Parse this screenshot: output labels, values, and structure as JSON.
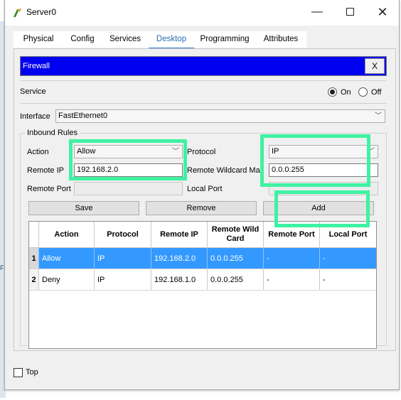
{
  "window": {
    "title": "Server0",
    "minimize": "—",
    "close": "✕"
  },
  "tabs": [
    "Physical",
    "Config",
    "Services",
    "Desktop",
    "Programming",
    "Attributes"
  ],
  "active_tab": "Desktop",
  "firewall": {
    "title": "Firewall",
    "close_label": "X"
  },
  "service": {
    "label": "Service",
    "on_label": "On",
    "off_label": "Off",
    "selected": "On"
  },
  "interface": {
    "label": "Interface",
    "value": "FastEthernet0"
  },
  "inbound_rules": {
    "title": "Inbound Rules",
    "action_label": "Action",
    "action_value": "Allow",
    "protocol_label": "Protocol",
    "protocol_value": "IP",
    "remote_ip_label": "Remote IP",
    "remote_ip_value": "192.168.2.0",
    "remote_wildcard_label": "Remote Wildcard Mas",
    "remote_wildcard_value": "0.0.0.255",
    "remote_port_label": "Remote Port",
    "remote_port_value": "",
    "local_port_label": "Local Port",
    "local_port_value": ""
  },
  "buttons": {
    "save": "Save",
    "remove": "Remove",
    "add": "Add"
  },
  "table": {
    "headers": [
      "",
      "Action",
      "Protocol",
      "Remote IP",
      "Remote Wild Card",
      "Remote Port",
      "Local Port"
    ],
    "rows": [
      {
        "num": "1",
        "action": "Allow",
        "protocol": "IP",
        "remote_ip": "192.168.2.0",
        "wildcard": "0.0.0.255",
        "remote_port": "-",
        "local_port": "-"
      },
      {
        "num": "2",
        "action": "Deny",
        "protocol": "IP",
        "remote_ip": "192.168.1.0",
        "wildcard": "0.0.0.255",
        "remote_port": "-",
        "local_port": "-"
      }
    ],
    "selected_row": 1
  },
  "footer": {
    "top_label": "Top",
    "top_checked": false
  },
  "colors": {
    "header_blue": "#0000f0",
    "selection_blue": "#3399ff",
    "highlight_green": "#3ef2a2",
    "tab_active": "#2b78c4"
  }
}
